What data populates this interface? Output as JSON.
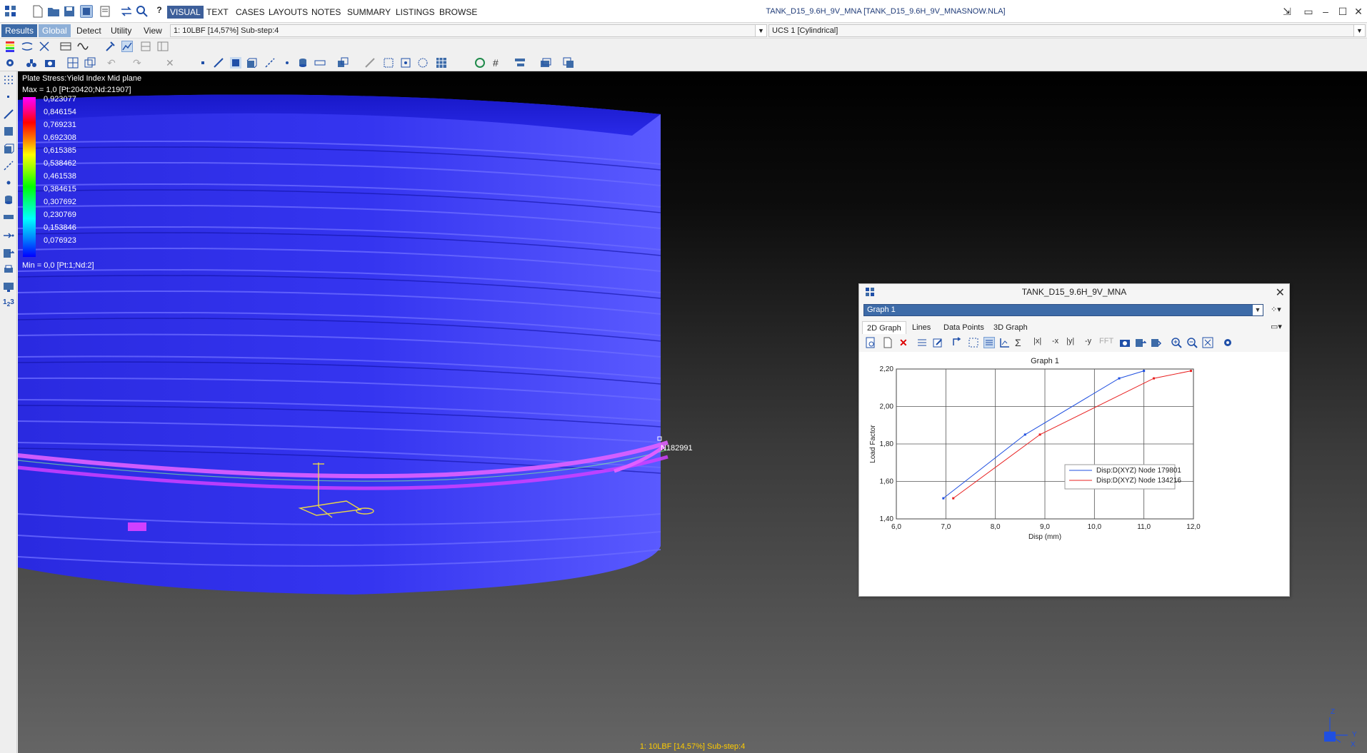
{
  "menubar": {
    "items": [
      "VISUAL",
      "TEXT",
      "CASES",
      "LAYOUTS",
      "NOTES",
      "SUMMARY",
      "LISTINGS",
      "BROWSE"
    ],
    "active": "VISUAL",
    "title": "TANK_D15_9.6H_9V_MNA [TANK_D15_9.6H_9V_MNASNOW.NLA]"
  },
  "row2": {
    "tabs": [
      "Results",
      "Global",
      "Detect",
      "Utility",
      "View"
    ],
    "load_case": "1: 10LBF [14,57%] Sub-step:4",
    "ucs": "UCS 1 [Cylindrical]"
  },
  "legend": {
    "title": "Plate Stress:Yield Index Mid plane",
    "max": "Max = 1,0 [Pt:20420;Nd:21907]",
    "min": "Min = 0,0 [Pt:1;Nd:2]",
    "values": [
      "0,923077",
      "0,846154",
      "0,769231",
      "0,692308",
      "0,615385",
      "0,538462",
      "0,461538",
      "0,384615",
      "0,307692",
      "0,230769",
      "0,153846",
      "0,076923"
    ]
  },
  "viewport": {
    "node_label": "N182991",
    "status": "1: 10LBF [14,57%] Sub-step:4",
    "axes": [
      "Z",
      "Y",
      "X"
    ]
  },
  "graph_window": {
    "title": "TANK_D15_9.6H_9V_MNA",
    "graph_select": "Graph 1",
    "tabs": [
      "2D Graph",
      "Lines",
      "Data Points",
      "3D Graph"
    ],
    "active_tab": "2D Graph",
    "toolbar_text": [
      "|x|",
      "-x",
      "|y|",
      "-y",
      "FFT"
    ]
  },
  "chart_data": {
    "type": "line",
    "title": "Graph 1",
    "xlabel": "Disp  (mm)",
    "ylabel": "Load Factor",
    "xlim": [
      6.0,
      12.0
    ],
    "ylim": [
      1.4,
      2.2
    ],
    "xticks": [
      "6,0",
      "7,0",
      "8,0",
      "9,0",
      "10,0",
      "11,0",
      "12,0"
    ],
    "yticks": [
      "1,40",
      "1,60",
      "1,80",
      "2,00",
      "2,20"
    ],
    "grid": true,
    "legend_position": "lower-right",
    "series": [
      {
        "name": "Disp:D(XYZ)  Node 179801",
        "color": "#1f4fe0",
        "points": [
          [
            6.95,
            1.51
          ],
          [
            8.6,
            1.85
          ],
          [
            10.5,
            2.15
          ],
          [
            11.0,
            2.19
          ]
        ]
      },
      {
        "name": "Disp:D(XYZ)  Node 134216",
        "color": "#e82020",
        "points": [
          [
            7.15,
            1.51
          ],
          [
            8.9,
            1.85
          ],
          [
            11.2,
            2.15
          ],
          [
            11.95,
            2.19
          ]
        ]
      }
    ]
  }
}
